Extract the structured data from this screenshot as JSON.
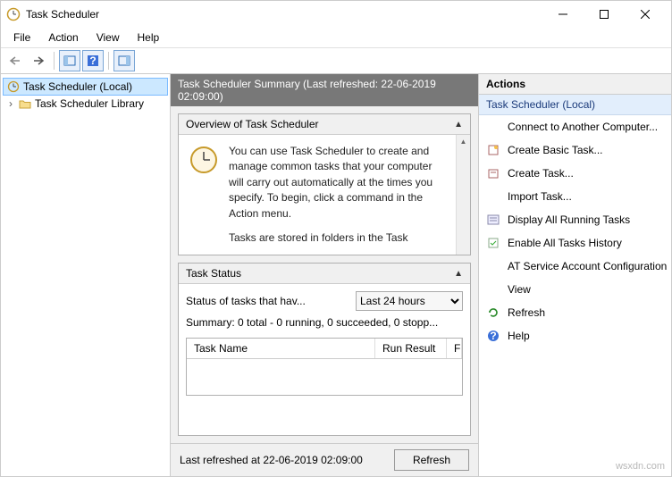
{
  "window": {
    "title": "Task Scheduler"
  },
  "menu": {
    "file": "File",
    "action": "Action",
    "view": "View",
    "help": "Help"
  },
  "tree": {
    "root": "Task Scheduler (Local)",
    "child": "Task Scheduler Library"
  },
  "center": {
    "header": "Task Scheduler Summary (Last refreshed: 22-06-2019 02:09:00)",
    "overview": {
      "title": "Overview of Task Scheduler",
      "text1": "You can use Task Scheduler to create and manage common tasks that your computer will carry out automatically at the times you specify. To begin, click a command in the Action menu.",
      "text2": "Tasks are stored in folders in the Task"
    },
    "status": {
      "title": "Task Status",
      "label": "Status of tasks that hav...",
      "select": "Last 24 hours",
      "summary": "Summary: 0 total - 0 running, 0 succeeded, 0 stopp...",
      "col1": "Task Name",
      "col2": "Run Result",
      "col3": "F"
    },
    "footer": {
      "text": "Last refreshed at 22-06-2019 02:09:00",
      "button": "Refresh"
    }
  },
  "actions": {
    "header": "Actions",
    "section": "Task Scheduler (Local)",
    "items": {
      "connect": "Connect to Another Computer...",
      "basic": "Create Basic Task...",
      "create": "Create Task...",
      "import": "Import Task...",
      "display": "Display All Running Tasks",
      "enable": "Enable All Tasks History",
      "at": "AT Service Account Configuration",
      "view": "View",
      "refresh": "Refresh",
      "help": "Help"
    }
  },
  "watermark": "wsxdn.com"
}
